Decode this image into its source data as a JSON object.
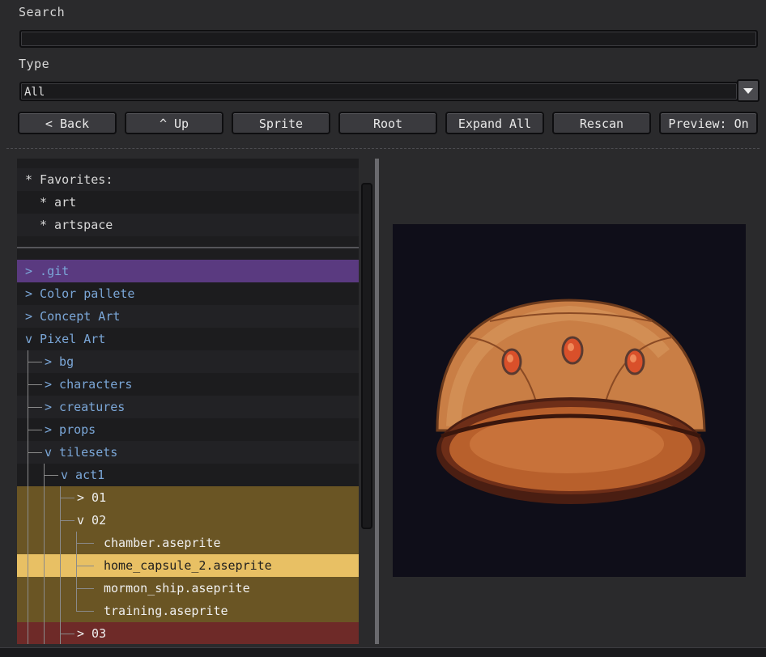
{
  "search": {
    "label": "Search",
    "value": ""
  },
  "type": {
    "label": "Type",
    "selected": "All"
  },
  "toolbar": {
    "back": "< Back",
    "up": "^ Up",
    "sprite": "Sprite",
    "root": "Root",
    "expand_all": "Expand All",
    "rescan": "Rescan",
    "preview": "Preview: On"
  },
  "favorites": {
    "header": "* Favorites:",
    "items": [
      "* art",
      "* artspace"
    ]
  },
  "tree": [
    {
      "label": "> .git"
    },
    {
      "label": "> Color pallete"
    },
    {
      "label": "> Concept Art"
    },
    {
      "label": "v Pixel Art"
    },
    {
      "label": "> bg"
    },
    {
      "label": "> characters"
    },
    {
      "label": "> creatures"
    },
    {
      "label": "> props"
    },
    {
      "label": "v tilesets"
    },
    {
      "label": "v act1"
    },
    {
      "label": "> 01"
    },
    {
      "label": "v 02"
    },
    {
      "label": "chamber.aseprite"
    },
    {
      "label": "home_capsule_2.aseprite"
    },
    {
      "label": "mormon_ship.aseprite"
    },
    {
      "label": "training.aseprite"
    },
    {
      "label": "> 03"
    }
  ],
  "colors": {
    "background": "#2a2a2c",
    "folder_text": "#7ba7d8",
    "git_highlight": "#5a3a80",
    "folder_highlight": "#6a5524",
    "selected_row": "#e8c064",
    "other_folder": "#6e2a28"
  },
  "preview": {
    "icon": "capsule-dome-sprite"
  }
}
